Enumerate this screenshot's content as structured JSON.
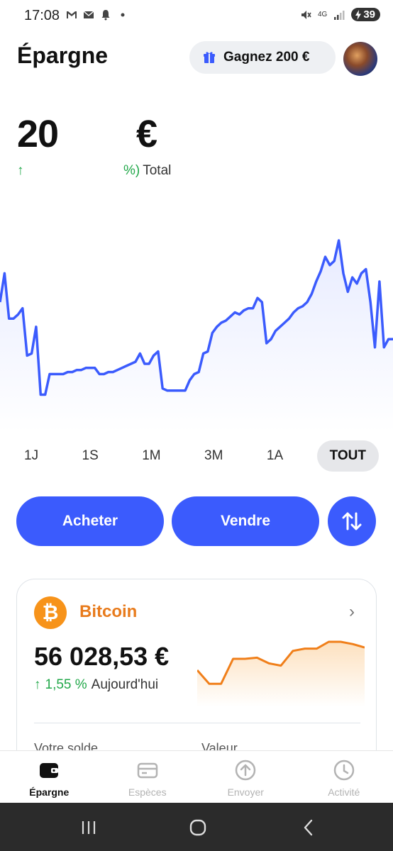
{
  "status_bar": {
    "time": "17:08",
    "network": "4G",
    "battery": "39"
  },
  "header": {
    "title": "Épargne",
    "promo_label": "Gagnez 200 €"
  },
  "balance": {
    "amount": "20",
    "currency": "€",
    "change_pct": "%)",
    "change_label": "Total"
  },
  "colors": {
    "accent": "#3b5bfd",
    "positive": "#22a84a",
    "bitcoin": "#f7931a",
    "bitcoin_text": "#e87b1c"
  },
  "time_ranges": [
    "1J",
    "1S",
    "1M",
    "3M",
    "1A",
    "TOUT"
  ],
  "selected_range": "TOUT",
  "actions": {
    "buy_label": "Acheter",
    "sell_label": "Vendre"
  },
  "asset_card": {
    "name": "Bitcoin",
    "value": "56 028,53 €",
    "change_pct": "1,55 %",
    "change_label": "Aujourd'hui",
    "balance_label": "Votre solde",
    "value_label": "Valeur"
  },
  "bottom_nav": [
    {
      "label": "Épargne",
      "icon": "wallet-icon",
      "active": true
    },
    {
      "label": "Espèces",
      "icon": "card-icon",
      "active": false
    },
    {
      "label": "Envoyer",
      "icon": "send-icon",
      "active": false
    },
    {
      "label": "Activité",
      "icon": "clock-icon",
      "active": false
    }
  ],
  "chart_data": [
    {
      "type": "line",
      "y": [
        60,
        74,
        52,
        52,
        54,
        57,
        34,
        35,
        48,
        15,
        15,
        25,
        25,
        25,
        25,
        26,
        26,
        27,
        27,
        28,
        28,
        28,
        25,
        25,
        26,
        26,
        27,
        28,
        29,
        30,
        31,
        35,
        30,
        30,
        34,
        36,
        18,
        17,
        17,
        17,
        17,
        17,
        22,
        25,
        26,
        35,
        36,
        45,
        48,
        50,
        51,
        53,
        55,
        54,
        56,
        57,
        57,
        62,
        60,
        40,
        42,
        46,
        48,
        50,
        52,
        55,
        57,
        58,
        60,
        64,
        70,
        75,
        82,
        78,
        80,
        90,
        74,
        65,
        72,
        69,
        74,
        76,
        60,
        38,
        70,
        38,
        42,
        42
      ]
    },
    {
      "type": "line",
      "y": [
        20,
        8,
        8,
        30,
        30,
        31,
        26,
        24,
        37,
        39,
        39,
        45,
        45,
        43,
        40
      ]
    }
  ]
}
